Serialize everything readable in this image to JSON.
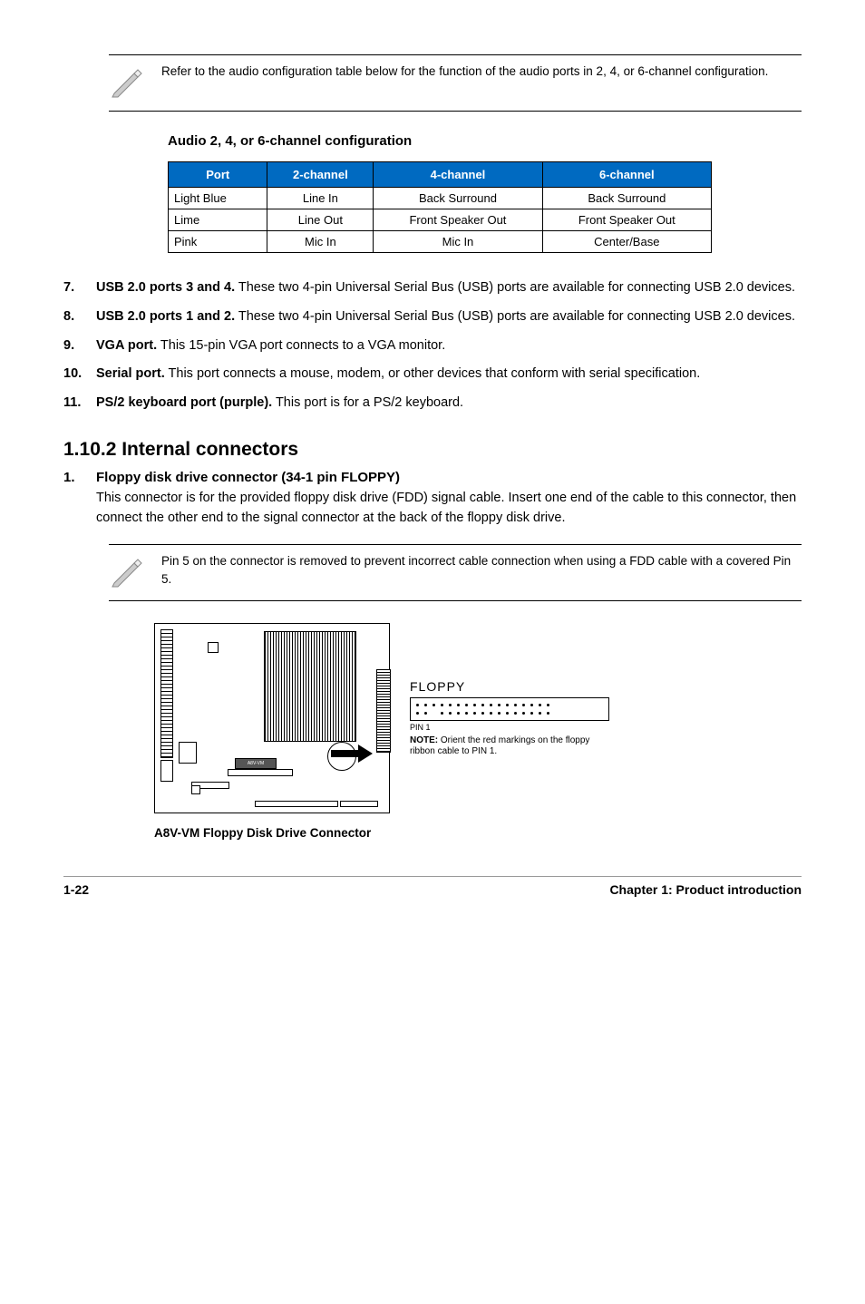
{
  "note_top": "Refer to the audio configuration table below for the function of the audio ports in 2, 4, or 6-channel configuration.",
  "audio_heading": "Audio 2, 4, or 6-channel configuration",
  "table": {
    "headers": [
      "Port",
      "2-channel",
      "4-channel",
      "6-channel"
    ],
    "rows": [
      [
        "Light Blue",
        "Line In",
        "Back Surround",
        "Back Surround"
      ],
      [
        "Lime",
        "Line Out",
        "Front Speaker Out",
        "Front Speaker Out"
      ],
      [
        "Pink",
        "Mic In",
        "Mic In",
        "Center/Base"
      ]
    ]
  },
  "items": [
    {
      "num": "7.",
      "lead": "USB 2.0 ports 3 and 4.",
      "rest": " These two 4-pin Universal Serial Bus (USB) ports are available for connecting USB 2.0 devices."
    },
    {
      "num": "8.",
      "lead": "USB 2.0 ports 1 and 2.",
      "rest": " These two 4-pin Universal Serial Bus (USB) ports are available for connecting USB 2.0 devices."
    },
    {
      "num": "9.",
      "lead": "VGA port.",
      "rest": " This 15-pin VGA port connects to a VGA monitor."
    },
    {
      "num": "10.",
      "lead": "Serial port.",
      "rest": " This port connects a mouse, modem, or other devices that conform with serial specification."
    },
    {
      "num": "11.",
      "lead": "PS/2 keyboard port (purple).",
      "rest": " This port is for a PS/2 keyboard."
    }
  ],
  "section_title": "1.10.2 Internal connectors",
  "floppy": {
    "num": "1.",
    "title": "Floppy disk drive connector (34-1 pin FLOPPY)",
    "desc": "This connector is for the provided floppy disk drive (FDD) signal cable. Insert one end of the cable to this connector, then connect the other end to the signal connector at the back of the floppy disk drive."
  },
  "note_pin5": "Pin 5 on the connector is removed to prevent incorrect cable connection when using a FDD cable with a covered Pin 5.",
  "figure": {
    "board_label": "A8V-VM",
    "conn_label": "FLOPPY",
    "pin1": "PIN 1",
    "note_bold": "NOTE:",
    "note_rest": " Orient the red markings on the floppy ribbon cable to PIN 1.",
    "caption": "A8V-VM Floppy Disk Drive Connector"
  },
  "footer_left": "1-22",
  "footer_right": "Chapter 1: Product introduction"
}
